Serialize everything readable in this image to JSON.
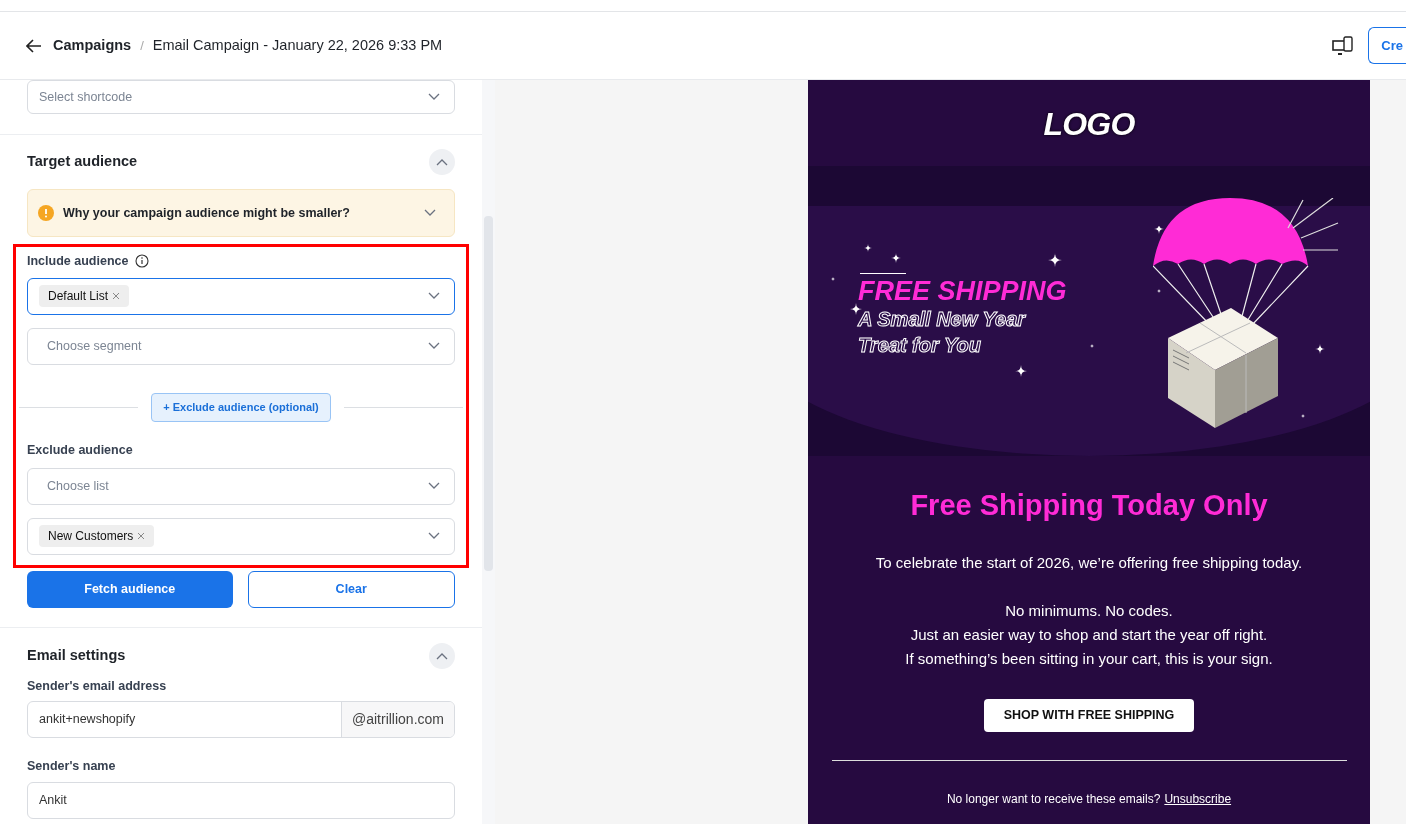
{
  "header": {
    "back_label": "Campaigns",
    "separator": "/",
    "title": "Email Campaign - January 22, 2026 9:33 PM",
    "create_button": "Cre"
  },
  "shortcode": {
    "placeholder": "Select shortcode"
  },
  "target_audience": {
    "title": "Target audience",
    "expanded": true,
    "notice": {
      "text": "Why your campaign audience might be smaller?",
      "expanded": false
    },
    "include": {
      "label": "Include audience",
      "lists": {
        "tags": [
          "Default List"
        ],
        "focused": true
      },
      "segments": {
        "placeholder": "Choose segment",
        "focused": false
      }
    },
    "exclude_button": "+ Exclude audience (optional)",
    "exclude": {
      "label": "Exclude audience",
      "lists": {
        "placeholder": "Choose list",
        "focused": false
      },
      "segments": {
        "tags": [
          "New Customers"
        ],
        "focused": false
      }
    },
    "fetch_button": "Fetch audience",
    "clear_button": "Clear"
  },
  "email_settings": {
    "title": "Email settings",
    "expanded": true,
    "sender_email_label": "Sender's email address",
    "sender_email_value": "ankit+newshopify",
    "sender_domain": "@aitrillion.com",
    "sender_name_label": "Sender's name",
    "sender_name_value": "Ankit"
  },
  "preview": {
    "logo": "LOGO",
    "banner_title": "FREE SHIPPING",
    "banner_subtitle_1": "A Small New Year",
    "banner_subtitle_2": "Treat for You",
    "heading": "Free Shipping Today Only",
    "paragraphs": [
      "To celebrate the start of 2026, we’re offering free shipping today.",
      "No minimums. No codes.\nJust an easier way to shop and start the year off right.\nIf something’s been sitting in your cart, this is your sign."
    ],
    "cta": "SHOP WITH FREE SHIPPING",
    "footer_text": "No longer want to receive these emails?",
    "unsubscribe": "Unsubscribe"
  }
}
